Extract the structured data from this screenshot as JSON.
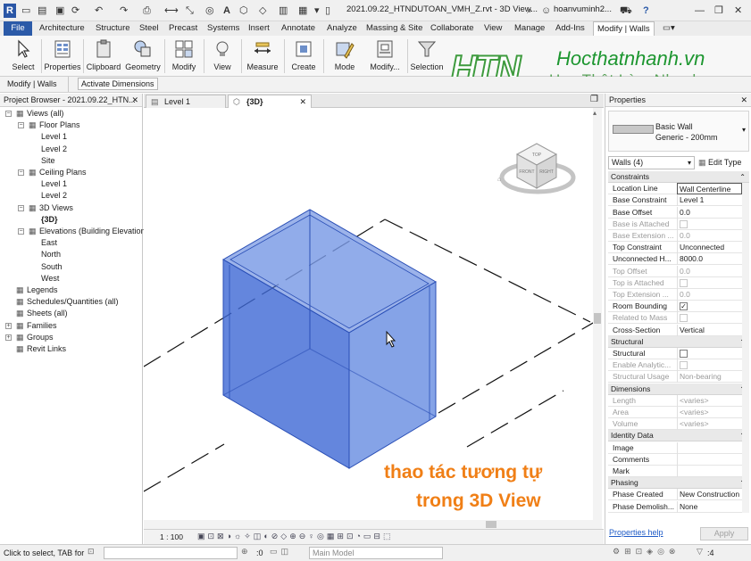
{
  "titlebar": {
    "app_letter": "R",
    "document_title": "2021.09.22_HTNDUTOAN_VMH_Z.rvt - 3D View...",
    "user": "hoanvuminh2...",
    "help": "?"
  },
  "ribbon_tabs": [
    "File",
    "Architecture",
    "Structure",
    "Steel",
    "Precast",
    "Systems",
    "Insert",
    "Annotate",
    "Analyze",
    "Massing & Site",
    "Collaborate",
    "View",
    "Manage",
    "Add-Ins",
    "Modify | Walls"
  ],
  "ribbon_buttons": [
    "Select",
    "Properties",
    "Clipboard",
    "Geometry",
    "Modify",
    "View",
    "Measure",
    "Create",
    "Mode",
    "Modify...",
    "Selection"
  ],
  "context_bar": {
    "label": "Modify | Walls",
    "button": "Activate Dimensions"
  },
  "brand": {
    "logo_text": "HTN",
    "site": "Hocthatnhanh.vn",
    "slogan": "Học Thật  Làm Nhanh"
  },
  "project_browser": {
    "title": "Project Browser - 2021.09.22_HTN...",
    "items": [
      {
        "label": "Views (all)",
        "level": 0,
        "toggle": "−"
      },
      {
        "label": "Floor Plans",
        "level": 1,
        "toggle": "−"
      },
      {
        "label": "Level 1",
        "level": 2,
        "toggle": ""
      },
      {
        "label": "Level 2",
        "level": 2,
        "toggle": ""
      },
      {
        "label": "Site",
        "level": 2,
        "toggle": ""
      },
      {
        "label": "Ceiling Plans",
        "level": 1,
        "toggle": "−"
      },
      {
        "label": "Level 1",
        "level": 2,
        "toggle": ""
      },
      {
        "label": "Level 2",
        "level": 2,
        "toggle": ""
      },
      {
        "label": "3D Views",
        "level": 1,
        "toggle": "−"
      },
      {
        "label": "{3D}",
        "level": 2,
        "toggle": ""
      },
      {
        "label": "Elevations (Building Elevation)",
        "level": 1,
        "toggle": "−"
      },
      {
        "label": "East",
        "level": 2,
        "toggle": ""
      },
      {
        "label": "North",
        "level": 2,
        "toggle": ""
      },
      {
        "label": "South",
        "level": 2,
        "toggle": ""
      },
      {
        "label": "West",
        "level": 2,
        "toggle": ""
      },
      {
        "label": "Legends",
        "level": 0,
        "toggle": ""
      },
      {
        "label": "Schedules/Quantities (all)",
        "level": 0,
        "toggle": ""
      },
      {
        "label": "Sheets (all)",
        "level": 0,
        "toggle": ""
      },
      {
        "label": "Families",
        "level": 0,
        "toggle": "+"
      },
      {
        "label": "Groups",
        "level": 0,
        "toggle": "+"
      },
      {
        "label": "Revit Links",
        "level": 0,
        "toggle": ""
      }
    ]
  },
  "view_tabs": [
    {
      "label": "Level 1",
      "active": false
    },
    {
      "label": "{3D}",
      "active": true
    }
  ],
  "viewcube": {
    "top": "TOP",
    "front": "FRONT",
    "right": "RIGHT"
  },
  "view_control": {
    "scale": "1 : 100"
  },
  "caption": {
    "line1": "thao tác tương tự",
    "line2": "trong 3D View"
  },
  "properties": {
    "title": "Properties",
    "type_family": "Basic Wall",
    "type_name": "Generic - 200mm",
    "selector": "Walls (4)",
    "edit_type": "Edit Type",
    "help_link": "Properties help",
    "apply": "Apply",
    "sections": [
      {
        "name": "Constraints",
        "rows": [
          {
            "k": "Location Line",
            "v": "Wall Centerline",
            "dim": false
          },
          {
            "k": "Base Constraint",
            "v": "Level 1",
            "dim": false
          },
          {
            "k": "Base Offset",
            "v": "0.0",
            "dim": false
          },
          {
            "k": "Base is Attached",
            "v": "",
            "dim": true,
            "check": true
          },
          {
            "k": "Base Extension ...",
            "v": "0.0",
            "dim": true
          },
          {
            "k": "Top Constraint",
            "v": "Unconnected",
            "dim": false
          },
          {
            "k": "Unconnected H...",
            "v": "8000.0",
            "dim": false
          },
          {
            "k": "Top Offset",
            "v": "0.0",
            "dim": true
          },
          {
            "k": "Top is Attached",
            "v": "",
            "dim": true,
            "check": true
          },
          {
            "k": "Top Extension ...",
            "v": "0.0",
            "dim": true
          },
          {
            "k": "Room Bounding",
            "v": "✓",
            "dim": false,
            "check": true
          },
          {
            "k": "Related to Mass",
            "v": "",
            "dim": true,
            "check": true
          },
          {
            "k": "Cross-Section",
            "v": "Vertical",
            "dim": false
          }
        ]
      },
      {
        "name": "Structural",
        "rows": [
          {
            "k": "Structural",
            "v": "",
            "dim": false,
            "check": true
          },
          {
            "k": "Enable Analytic...",
            "v": "",
            "dim": true,
            "check": true
          },
          {
            "k": "Structural Usage",
            "v": "Non-bearing",
            "dim": true
          }
        ]
      },
      {
        "name": "Dimensions",
        "rows": [
          {
            "k": "Length",
            "v": "<varies>",
            "dim": true
          },
          {
            "k": "Area",
            "v": "<varies>",
            "dim": true
          },
          {
            "k": "Volume",
            "v": "<varies>",
            "dim": true
          }
        ]
      },
      {
        "name": "Identity Data",
        "rows": [
          {
            "k": "Image",
            "v": "",
            "dim": false
          },
          {
            "k": "Comments",
            "v": "",
            "dim": false
          },
          {
            "k": "Mark",
            "v": "",
            "dim": false
          }
        ]
      },
      {
        "name": "Phasing",
        "rows": [
          {
            "k": "Phase Created",
            "v": "New Construction",
            "dim": false
          },
          {
            "k": "Phase Demolish...",
            "v": "None",
            "dim": false
          }
        ]
      }
    ]
  },
  "status_bar": {
    "hint": "Click to select, TAB for a",
    "zero": ":0",
    "model": "Main Model",
    "filter_count": ":4"
  }
}
